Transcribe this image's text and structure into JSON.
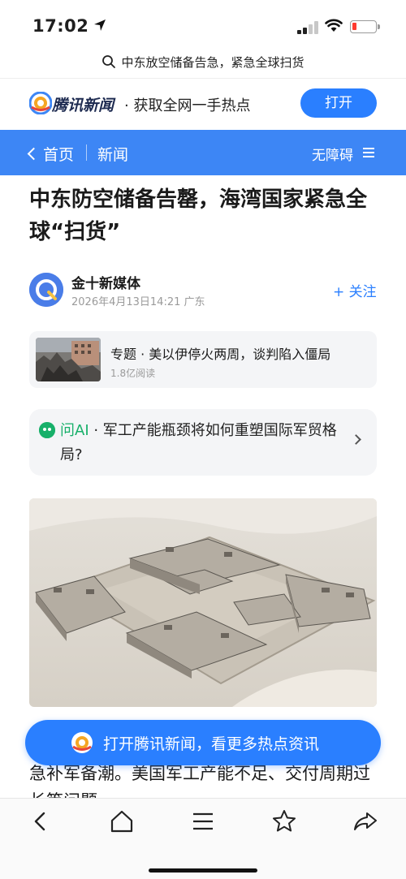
{
  "status_bar": {
    "time": "17:02"
  },
  "url_bar": {
    "text": "中东放空储备告急，紧急全球扫货"
  },
  "app_banner": {
    "app_name": "腾讯新闻",
    "slogan": "· 获取全网一手热点",
    "open_label": "打开"
  },
  "nav": {
    "back_label": "首页",
    "title": "新闻",
    "accessibility_label": "无障碍"
  },
  "article": {
    "headline": "中东防空储备告罄，海湾国家紧急全球“扫货”",
    "author": "金十新媒体",
    "meta": "2026年4月13日14:21 广东",
    "follow_label": "+ 关注",
    "body_text": "急补军备潮。美国军工产能不足、交付周期过长等问题……"
  },
  "topic": {
    "title": "专题 · 美以伊停火两周，谈判陷入僵局",
    "reads": "1.8亿阅读"
  },
  "ai_card": {
    "label": "问AI",
    "question": " · 军工产能瓶颈将如何重塑国际军贸格局?"
  },
  "cta": {
    "text": "打开腾讯新闻，看更多热点资讯"
  },
  "toolbar": {
    "icons": [
      "back-icon",
      "home-icon",
      "menu-icon",
      "star-icon",
      "share-icon"
    ]
  },
  "colors": {
    "brand_blue": "#3d86f5",
    "button_blue": "#2a7fff",
    "ai_green": "#18b06a"
  }
}
